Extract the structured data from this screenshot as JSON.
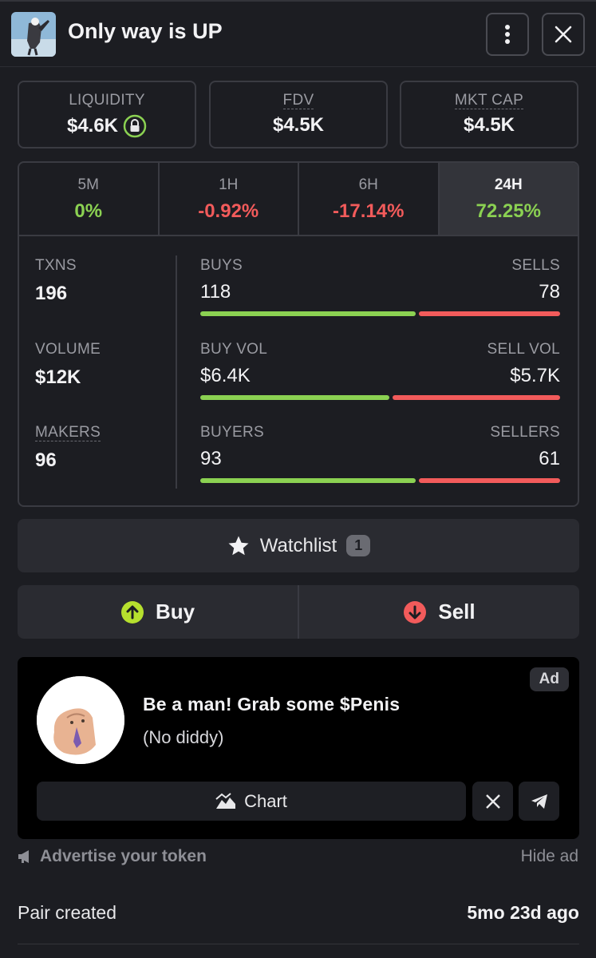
{
  "header": {
    "title": "Only way is UP"
  },
  "stats": {
    "liquidity": {
      "label": "LIQUIDITY",
      "value": "$4.6K"
    },
    "fdv": {
      "label": "FDV",
      "value": "$4.5K"
    },
    "mkt_cap": {
      "label": "MKT CAP",
      "value": "$4.5K"
    }
  },
  "timeframes": [
    {
      "label": "5M",
      "value": "0%",
      "trend": "pos"
    },
    {
      "label": "1H",
      "value": "-0.92%",
      "trend": "neg"
    },
    {
      "label": "6H",
      "value": "-17.14%",
      "trend": "neg"
    },
    {
      "label": "24H",
      "value": "72.25%",
      "trend": "pos",
      "active": true
    }
  ],
  "metrics": {
    "txns": {
      "label": "TXNS",
      "value": "196"
    },
    "volume": {
      "label": "VOLUME",
      "value": "$12K"
    },
    "makers": {
      "label": "MAKERS",
      "value": "96"
    }
  },
  "splits": {
    "buys": {
      "left_label": "BUYS",
      "right_label": "SELLS",
      "left_value": "118",
      "right_value": "78",
      "buy_share": 0.602
    },
    "vol": {
      "left_label": "BUY VOL",
      "right_label": "SELL VOL",
      "left_value": "$6.4K",
      "right_value": "$5.7K",
      "buy_share": 0.529
    },
    "buyers": {
      "left_label": "BUYERS",
      "right_label": "SELLERS",
      "left_value": "93",
      "right_value": "61",
      "buy_share": 0.604
    }
  },
  "watchlist": {
    "label": "Watchlist",
    "count": "1"
  },
  "trade": {
    "buy_label": "Buy",
    "sell_label": "Sell"
  },
  "ad": {
    "tag": "Ad",
    "title": "Be a man! Grab some $Penis",
    "subtitle": "(No diddy)",
    "chart_label": "Chart"
  },
  "footer": {
    "advertise_label": "Advertise your token",
    "hide_ad_label": "Hide ad"
  },
  "pair": {
    "label": "Pair created",
    "value": "5mo 23d ago"
  },
  "colors": {
    "positive": "#8bd152",
    "negative": "#f25b5b",
    "background": "#1c1d22"
  }
}
